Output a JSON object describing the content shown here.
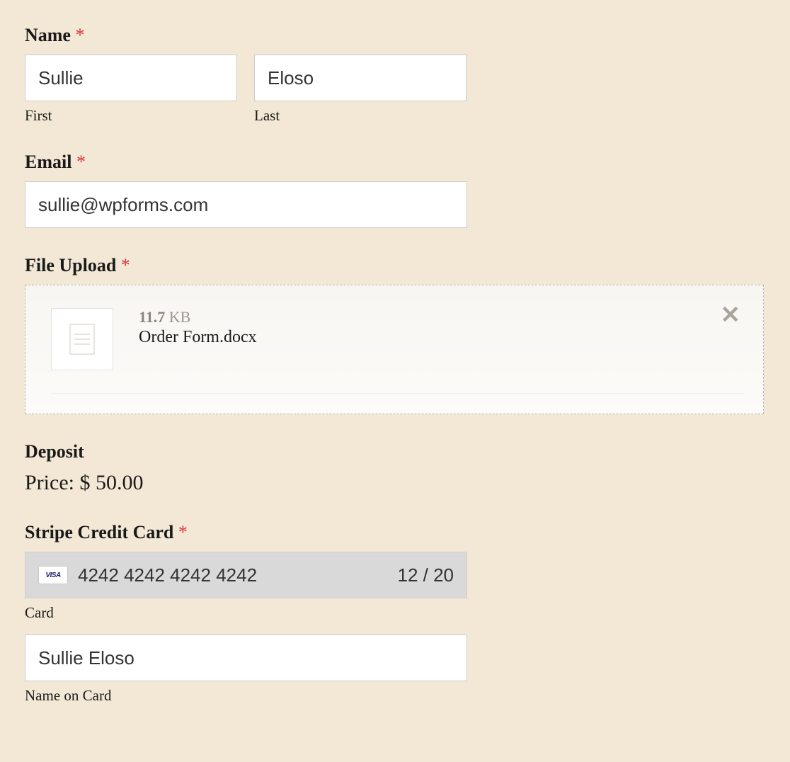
{
  "name": {
    "label": "Name",
    "required": "*",
    "first_value": "Sullie",
    "first_sublabel": "First",
    "last_value": "Eloso",
    "last_sublabel": "Last"
  },
  "email": {
    "label": "Email",
    "required": "*",
    "value": "sullie@wpforms.com"
  },
  "upload": {
    "label": "File Upload",
    "required": "*",
    "file_size_num": "11.7",
    "file_size_unit": "KB",
    "file_name": "Order Form.docx"
  },
  "deposit": {
    "label": "Deposit",
    "price_text": "Price: $ 50.00"
  },
  "cc": {
    "label": "Stripe Credit Card",
    "required": "*",
    "brand": "VISA",
    "number": "4242 4242 4242 4242",
    "expiry": "12 / 20",
    "sublabel": "Card",
    "name_on_card": "Sullie Eloso",
    "name_sublabel": "Name on Card"
  }
}
